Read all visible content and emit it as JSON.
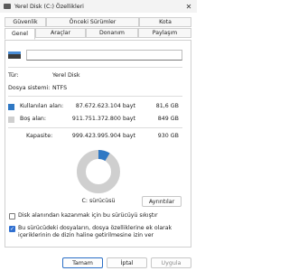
{
  "window": {
    "title": "Yerel Disk (C:) Özellikleri",
    "close_symbol": "✕"
  },
  "tabs": {
    "row1": [
      "Güvenlik",
      "Önceki Sürümler",
      "Kota"
    ],
    "row2": [
      "Genel",
      "Araçlar",
      "Donanım",
      "Paylaşım"
    ],
    "active": "Genel"
  },
  "general": {
    "type_label": "Tür:",
    "type_value": "Yerel Disk",
    "fs_label": "Dosya sistemi:",
    "fs_value": "NTFS",
    "used_label": "Kullanılan alan:",
    "used_bytes": "87.672.623.104 bayt",
    "used_gb": "81,6 GB",
    "free_label": "Boş alan:",
    "free_bytes": "911.751.372.800 bayt",
    "free_gb": "849 GB",
    "cap_label": "Kapasite:",
    "cap_bytes": "999.423.995.904 bayt",
    "cap_gb": "930 GB",
    "drive_label": "C: sürücüsü",
    "cleanup_button": "Ayrıntılar",
    "compress_text": "Disk alanından kazanmak için bu sürücüyü sıkıştır",
    "index_text_1": "Bu sürücüdeki dosyaların, dosya özelliklerine ek olarak",
    "index_text_2": "içeriklerinin de dizin haline getirilmesine izin ver",
    "compress_checked": false,
    "index_checked": true,
    "check_mark": "✓"
  },
  "colors": {
    "used": "#2f78c4",
    "free": "#cfcfcf",
    "accent": "#2b6fc6"
  },
  "usage": {
    "used_fraction": 0.0877
  },
  "buttons": {
    "ok": "Tamam",
    "cancel": "İptal",
    "apply": "Uygula"
  }
}
